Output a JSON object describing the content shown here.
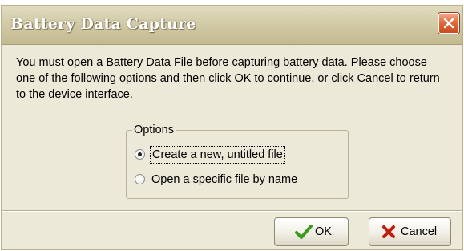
{
  "window": {
    "title": "Battery Data Capture"
  },
  "message": "You must open a Battery Data File before capturing battery data. Please choose one of the following options and then click OK to continue, or click Cancel to return to the device interface.",
  "options": {
    "legend": "Options",
    "items": [
      {
        "label": "Create a new, untitled file",
        "selected": true
      },
      {
        "label": "Open a specific file by name",
        "selected": false
      }
    ]
  },
  "buttons": {
    "ok_label": "OK",
    "cancel_label": "Cancel"
  },
  "icons": {
    "close": "close-icon",
    "ok": "checkmark-icon",
    "cancel": "x-mark-icon"
  },
  "colors": {
    "ok_icon": "#3a9a1e",
    "cancel_icon": "#c21c0e",
    "close_button": "#e26a3e"
  }
}
